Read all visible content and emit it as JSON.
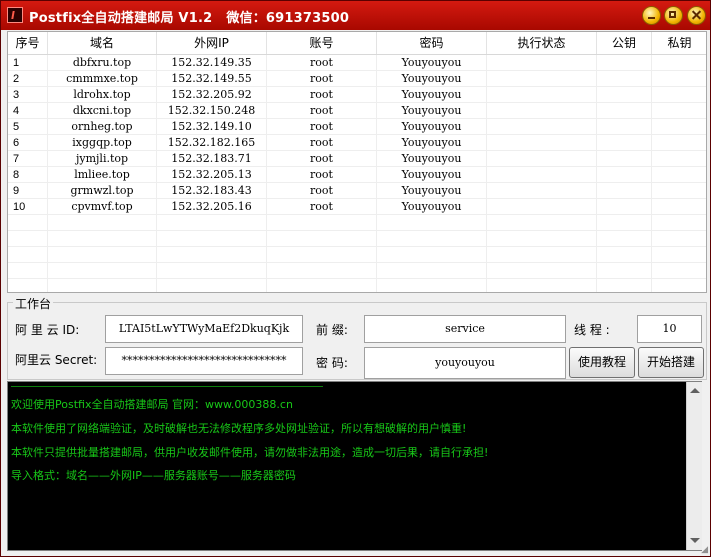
{
  "window": {
    "title": "Postfix全自动搭建邮局 V1.2",
    "wechat": "微信：691373500",
    "accent": "#c8100a"
  },
  "table": {
    "columns": [
      "序号",
      "域名",
      "外网IP",
      "账号",
      "密码",
      "执行状态",
      "公钥",
      "私钥"
    ],
    "rows": [
      [
        "1",
        "dbfxru.top",
        "152.32.149.35",
        "root",
        "Youyouyou"
      ],
      [
        "2",
        "cmmmxe.top",
        "152.32.149.55",
        "root",
        "Youyouyou"
      ],
      [
        "3",
        "ldrohx.top",
        "152.32.205.92",
        "root",
        "Youyouyou"
      ],
      [
        "4",
        "dkxcni.top",
        "152.32.150.248",
        "root",
        "Youyouyou"
      ],
      [
        "5",
        "ornheg.top",
        "152.32.149.10",
        "root",
        "Youyouyou"
      ],
      [
        "6",
        "ixggqp.top",
        "152.32.182.165",
        "root",
        "Youyouyou"
      ],
      [
        "7",
        "jymjli.top",
        "152.32.183.71",
        "root",
        "Youyouyou"
      ],
      [
        "8",
        "lmliee.top",
        "152.32.205.13",
        "root",
        "Youyouyou"
      ],
      [
        "9",
        "grmwzl.top",
        "152.32.183.43",
        "root",
        "Youyouyou"
      ],
      [
        "10",
        "cpvmvf.top",
        "152.32.205.16",
        "root",
        "Youyouyou"
      ]
    ]
  },
  "workbench": {
    "legend": "工作台",
    "aliyun_id_label": "阿 里 云 ID:",
    "aliyun_id_value": "LTAI5tLwYTWyMaEf2DkuqKjk",
    "aliyun_secret_label": "阿里云 Secret:",
    "aliyun_secret_value": "******************************",
    "prefix_label": "前 缀:",
    "prefix_value": "service",
    "password_label": "密 码:",
    "password_value": "youyouyou",
    "threads_label": "线 程 :",
    "threads_value": "10",
    "tutorial_button": "使用教程",
    "start_button": "开始搭建"
  },
  "log": {
    "lines": [
      "欢迎使用Postfix全自动搭建邮局 官网：www.000388.cn",
      "本软件使用了网络端验证，及时破解也无法修改程序多处网址验证，所以有想破解的用户慎重!",
      "本软件只提供批量搭建邮局，供用户收发邮件使用，请勿做非法用途，造成一切后果，请自行承担!",
      "导入格式：域名——外网IP——服务器账号——服务器密码"
    ]
  }
}
